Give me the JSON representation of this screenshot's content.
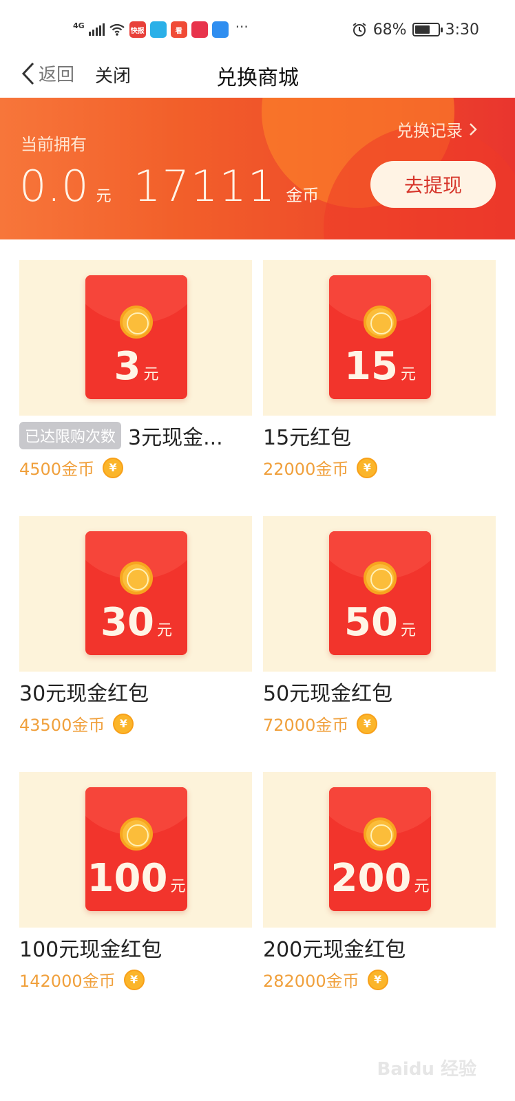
{
  "status_bar": {
    "network": "4G",
    "apps": [
      {
        "icon": "kuaibao-icon",
        "label": "快报",
        "color": "#e8403a"
      },
      {
        "icon": "play-icon",
        "label": "",
        "color": "#2bb0e8"
      },
      {
        "icon": "kan-icon",
        "label": "看",
        "color": "#f04b36"
      },
      {
        "icon": "video-icon",
        "label": "",
        "color": "#e8344c"
      },
      {
        "icon": "browser-icon",
        "label": "",
        "color": "#2f8ef0"
      }
    ],
    "more": "···",
    "battery_percent": "68%",
    "battery_level": 0.68,
    "time": "3:30"
  },
  "nav": {
    "back_label": "返回",
    "close_label": "关闭",
    "title": "兑换商城"
  },
  "banner": {
    "owned_label": "当前拥有",
    "cash_value": "0.0",
    "cash_unit": "元",
    "coin_value": "17111",
    "coin_unit": "金币",
    "record_label": "兑换记录",
    "withdraw_label": "去提现"
  },
  "products": [
    {
      "amount": "3",
      "unit": "元",
      "badge": "已达限购次数",
      "title": "3元现金...",
      "price": "4500金币"
    },
    {
      "amount": "15",
      "unit": "元",
      "badge": "",
      "title": "15元红包",
      "price": "22000金币"
    },
    {
      "amount": "30",
      "unit": "元",
      "badge": "",
      "title": "30元现金红包",
      "price": "43500金币"
    },
    {
      "amount": "50",
      "unit": "元",
      "badge": "",
      "title": "50元现金红包",
      "price": "72000金币"
    },
    {
      "amount": "100",
      "unit": "元",
      "badge": "",
      "title": "100元现金红包",
      "price": "142000金币"
    },
    {
      "amount": "200",
      "unit": "元",
      "badge": "",
      "title": "200元现金红包",
      "price": "282000金币"
    }
  ],
  "coin_symbol": "¥",
  "colors": {
    "banner_start": "#f7763a",
    "banner_end": "#e9352e",
    "envelope": "#f2342c",
    "price": "#f0a03c",
    "badge": "#c8c8cc"
  }
}
